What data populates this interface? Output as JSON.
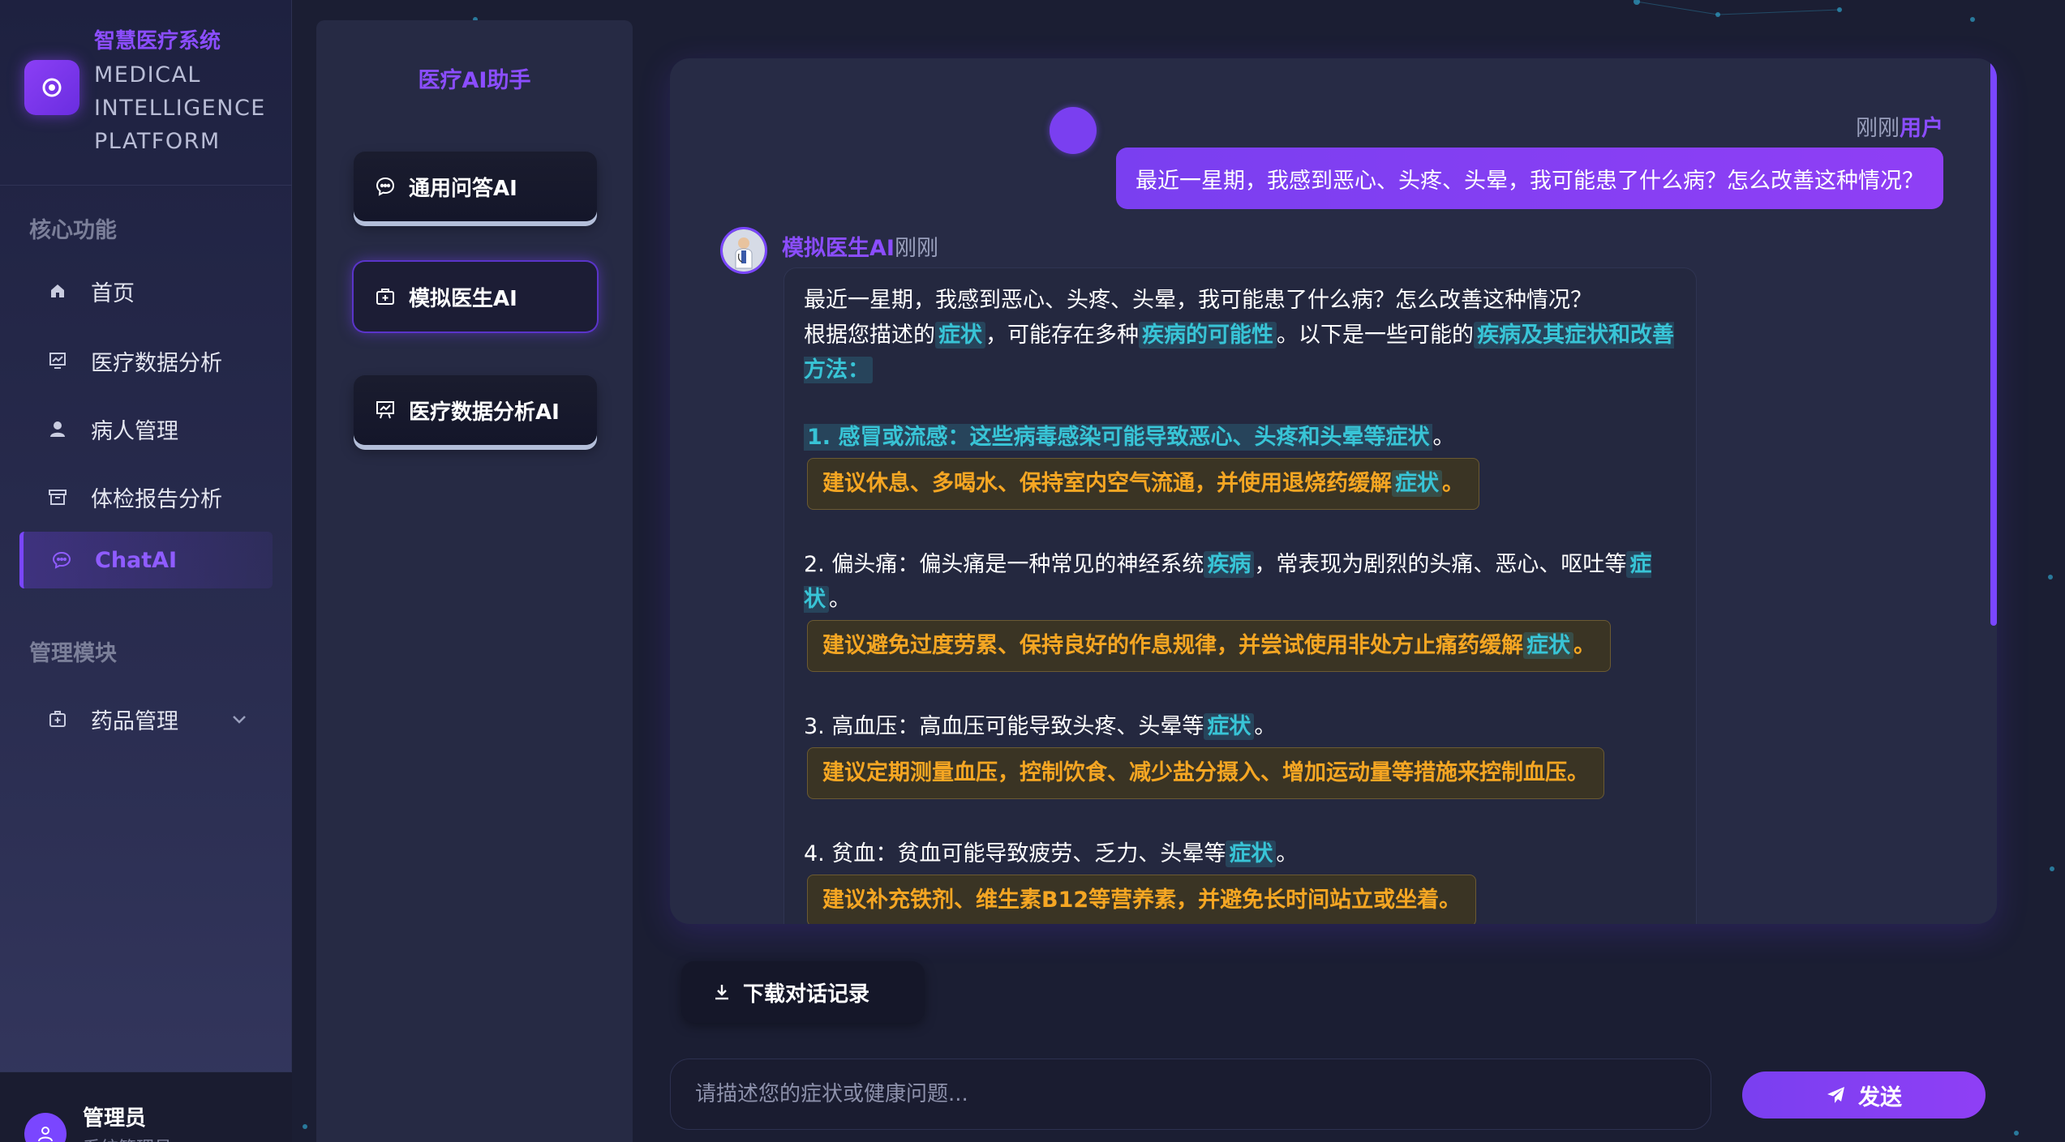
{
  "brand": {
    "title": "智慧医疗系统",
    "sub_line1": "MEDICAL",
    "sub_line2": "INTELLIGENCE",
    "sub_line3": "PLATFORM"
  },
  "sidebar": {
    "section_core": "核心功能",
    "items": [
      {
        "label": "首页",
        "icon": "home-icon"
      },
      {
        "label": "医疗数据分析",
        "icon": "chart-icon"
      },
      {
        "label": "病人管理",
        "icon": "user-icon"
      },
      {
        "label": "体检报告分析",
        "icon": "archive-icon"
      },
      {
        "label": "ChatAI",
        "icon": "chat-icon",
        "active": true
      }
    ],
    "section_admin": "管理模块",
    "admin_items": [
      {
        "label": "药品管理",
        "icon": "medicine-icon",
        "expandable": true
      }
    ]
  },
  "user": {
    "name": "管理员",
    "role": "系统管理员"
  },
  "assistant": {
    "title": "医疗AI助手",
    "buttons": [
      {
        "label": "通用问答AI",
        "icon": "chat-bubble-icon"
      },
      {
        "label": "模拟医生AI",
        "icon": "medical-kit-icon",
        "active": true
      },
      {
        "label": "医疗数据分析AI",
        "icon": "presentation-icon"
      }
    ]
  },
  "chat": {
    "user_message": {
      "time": "刚刚",
      "sender": "用户",
      "text": "最近一星期，我感到恶心、头疼、头晕，我可能患了什么病？怎么改善这种情况？"
    },
    "ai_message": {
      "sender": "模拟医生AI",
      "time": "刚刚",
      "echo": "最近一星期，我感到恶心、头疼、头晕，我可能患了什么病？怎么改善这种情况？",
      "intro_a": "根据您描述的",
      "intro_hl1": "症状",
      "intro_b": "，可能存在多种",
      "intro_hl2": "疾病的可能性",
      "intro_c": "。以下是一些可能的",
      "intro_hl3": "疾病及其症状和改善方法：",
      "item1_title": "1. 感冒或流感：这些病毒感染可能导致恶心、头疼和头晕等症状",
      "item1_end": "。",
      "item1_advice": "建议休息、多喝水、保持室内空气流通，并使用退烧药缓解",
      "item1_advice_hl": "症状",
      "item1_advice_end": "。",
      "item2_a": "2. 偏头痛：偏头痛是一种常见的神经系统",
      "item2_hl1": "疾病",
      "item2_b": "，常表现为剧烈的头痛、恶心、呕吐等",
      "item2_hl2": "症状",
      "item2_end": "。",
      "item2_advice": "建议避免过度劳累、保持良好的作息规律，并尝试使用非处方止痛药缓解",
      "item2_advice_hl": "症状",
      "item2_advice_end": "。",
      "item3_a": "3. 高血压：高血压可能导致头疼、头晕等",
      "item3_hl": "症状",
      "item3_end": "。",
      "item3_advice": "建议定期测量血压，控制饮食、减少盐分摄入、增加运动量等措施来控制血压。",
      "item4_a": "4. 贫血：贫血可能导致疲劳、乏力、头晕等",
      "item4_hl": "症状",
      "item4_end": "。",
      "item4_advice": "建议补充铁剂、维生素B12等营养素，并避免长时间站立或坐着。"
    }
  },
  "actions": {
    "download_label": "下载对话记录",
    "input_placeholder": "请描述您的症状或健康问题...",
    "send_label": "发送"
  },
  "colors": {
    "accent": "#7a46ff",
    "highlight": "#38c4d6",
    "advice": "#f5a623",
    "background": "#1b1e33"
  }
}
